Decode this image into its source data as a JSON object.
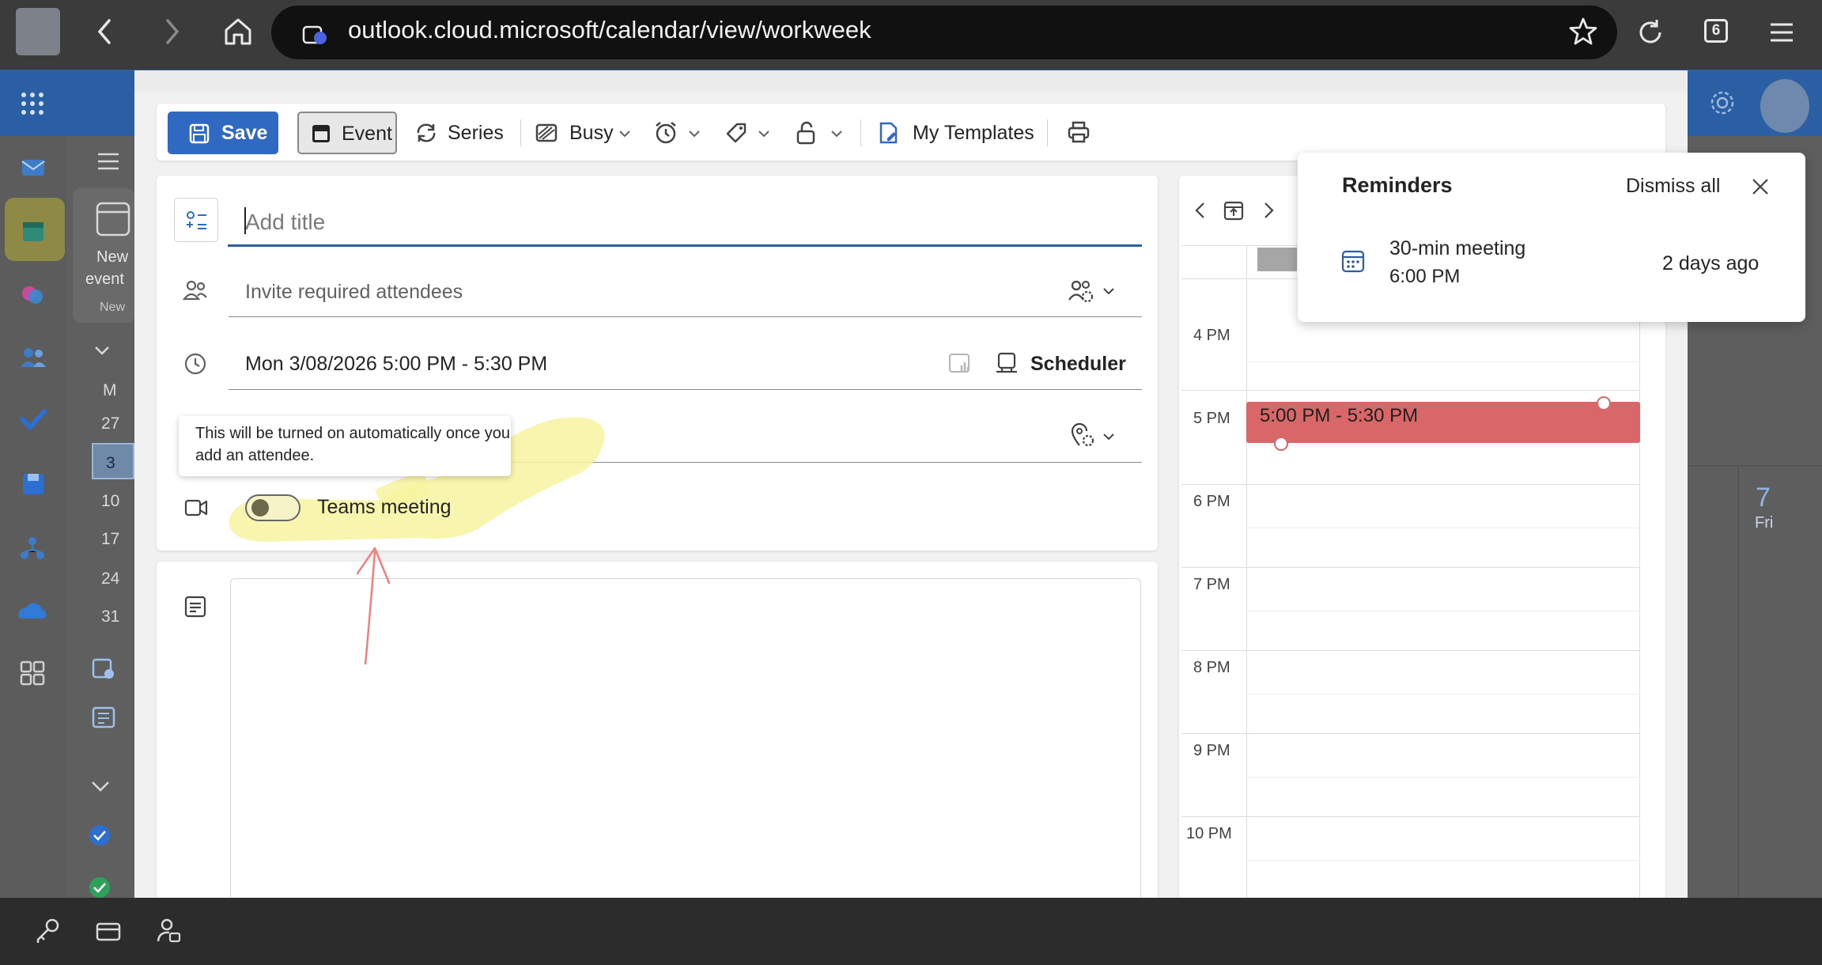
{
  "browser": {
    "url": "outlook.cloud.microsoft/calendar/view/workweek",
    "tab_count": "6"
  },
  "app_bg": {
    "new_event_label_1": "New",
    "new_event_label_2": "event",
    "new_group_label": "New",
    "mini_calendar": {
      "day_header": "M",
      "days": [
        "27",
        "3",
        "10",
        "17",
        "24",
        "31"
      ]
    },
    "day_number": "7",
    "day_name": "Fri"
  },
  "toolbar": {
    "save_label": "Save",
    "event_label": "Event",
    "series_label": "Series",
    "busy_label": "Busy",
    "templates_label": "My Templates"
  },
  "form": {
    "title_placeholder": "Add title",
    "attendees_placeholder": "Invite required attendees",
    "datetime": "Mon 3/08/2026 5:00 PM - 5:30 PM",
    "scheduler_label": "Scheduler",
    "tooltip_text": "This will be turned on automatically once you add an attendee.",
    "teams_label": "Teams meeting",
    "teams_enabled": false
  },
  "calendar_panel": {
    "hours": [
      "4 PM",
      "5 PM",
      "6 PM",
      "7 PM",
      "8 PM",
      "9 PM",
      "10 PM"
    ],
    "event_time": "5:00 PM - 5:30 PM",
    "event_color": "#d9676a"
  },
  "reminders": {
    "title": "Reminders",
    "dismiss_all": "Dismiss all",
    "item_title": "30-min meeting",
    "item_time": "6:00 PM",
    "item_ago": "2 days ago"
  },
  "colors": {
    "accent": "#2f69c1",
    "outlook_header": "#2a5fa3",
    "highlight": "#f7f3a0",
    "annotation_arrow": "#f08080"
  }
}
